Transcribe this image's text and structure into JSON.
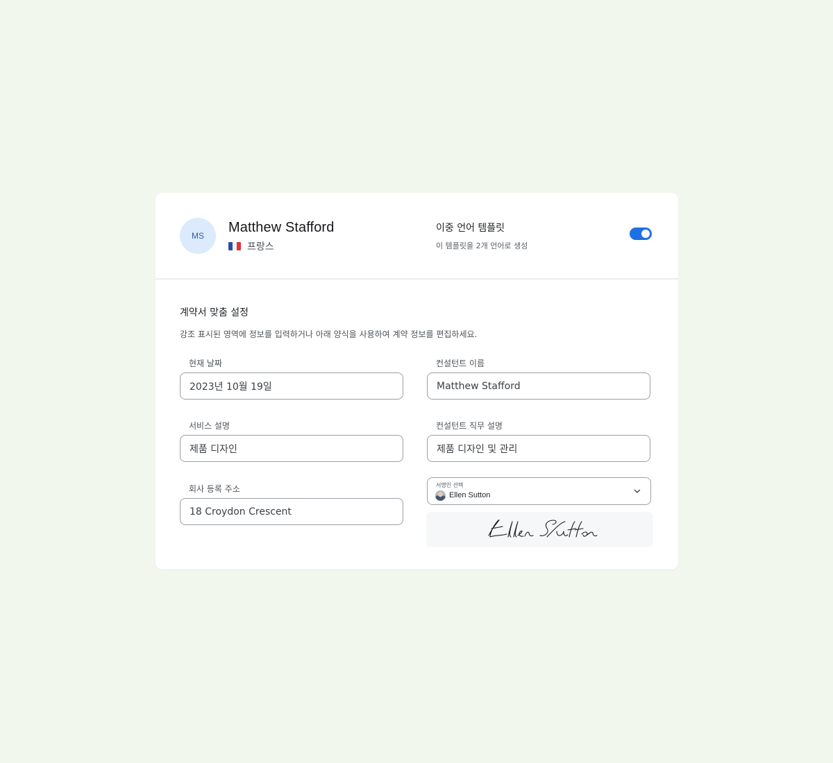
{
  "profile": {
    "initials": "MS",
    "name": "Matthew Stafford",
    "country": "프랑스",
    "flag_icon": "france-flag-icon"
  },
  "bilingual": {
    "title": "이중 언어 템플릿",
    "subtitle": "이 템플릿을 2개 언어로 생성",
    "enabled": true
  },
  "contract": {
    "title": "계약서 맞춤 설정",
    "description": "강조 표시된 영역에 정보를 입력하거나 아래 양식을 사용하여 계약 정보를 편집하세요.",
    "fields": {
      "current_date": {
        "label": "현재 날짜",
        "value": "2023년 10월 19일"
      },
      "consultant_name": {
        "label": "컨설턴트 이름",
        "value": "Matthew Stafford"
      },
      "service_description": {
        "label": "서비스 설명",
        "value": "제품 디자인"
      },
      "consultant_role": {
        "label": "컨설턴트 직무 설명",
        "value": "제품 디자인 및 관리"
      },
      "company_address": {
        "label": "회사 등록 주소",
        "value": "18 Croydon Crescent"
      }
    },
    "signer_select": {
      "label": "서명인 선택",
      "value": "Ellen Sutton"
    },
    "signature": {
      "text": "Ellen Sutton"
    }
  },
  "colors": {
    "background": "#f1f7ed",
    "accent": "#1f6fe5",
    "avatar_bg": "#dcebfb"
  }
}
